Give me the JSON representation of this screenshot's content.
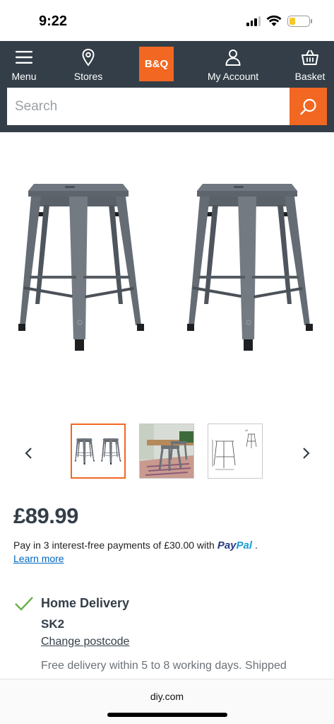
{
  "status_bar": {
    "time": "9:22",
    "icons": [
      "signal-icon",
      "wifi-icon",
      "battery-icon"
    ],
    "battery_color": "#f7c927"
  },
  "nav": {
    "items": [
      {
        "label": "Menu",
        "icon": "hamburger-icon"
      },
      {
        "label": "Stores",
        "icon": "location-pin-icon"
      },
      {
        "label": "My Account",
        "icon": "user-icon"
      },
      {
        "label": "Basket",
        "icon": "basket-icon"
      }
    ],
    "logo_text": "B&Q",
    "background_color": "#333e48",
    "brand_color": "#f26722"
  },
  "search": {
    "placeholder": "Search",
    "value": "",
    "button_icon": "search-icon"
  },
  "carousel": {
    "prev_icon": "chevron-left-icon",
    "next_icon": "chevron-right-icon",
    "thumbnails": [
      {
        "label": "product-front-view",
        "active": true
      },
      {
        "label": "product-lifestyle-view",
        "active": false
      },
      {
        "label": "product-dimensions-view",
        "active": false
      }
    ]
  },
  "product": {
    "price": "£89.99",
    "paypal_text": "Pay in 3 interest-free payments of £30.00 with",
    "paypal_logo_pay": "Pay",
    "paypal_logo_pal": "Pal",
    "paypal_suffix": ".",
    "learn_more": "Learn more"
  },
  "delivery": {
    "title": "Home Delivery",
    "postcode": "SK2",
    "change_postcode": "Change postcode",
    "info": "Free delivery within 5 to 8 working days. Shipped",
    "check_color": "#6ab04c"
  },
  "browser": {
    "url": "diy.com"
  }
}
